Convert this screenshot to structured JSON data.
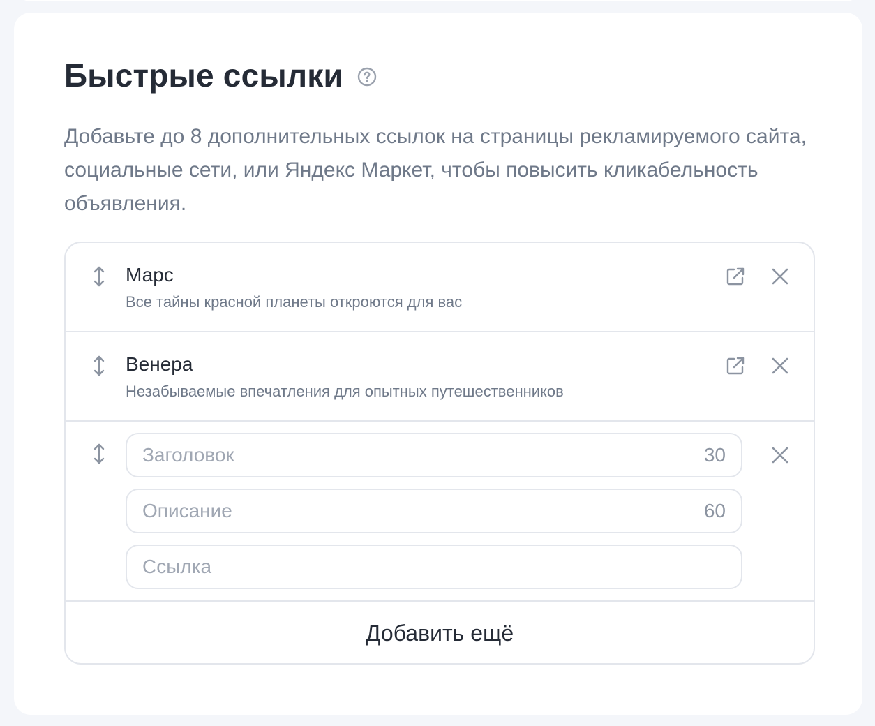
{
  "section": {
    "title": "Быстрые ссылки",
    "description": "Добавьте до 8 дополнительных ссылок на страницы рекламируемого сайта, социальные сети, или Яндекс Маркет, чтобы повысить кликабельность объявления."
  },
  "links": [
    {
      "title": "Марс",
      "description": "Все тайны красной планеты откроются для вас"
    },
    {
      "title": "Венера",
      "description": "Незабываемые впечатления для опытных путешественников"
    }
  ],
  "new_link": {
    "title_placeholder": "Заголовок",
    "title_counter": "30",
    "description_placeholder": "Описание",
    "description_counter": "60",
    "url_placeholder": "Ссылка"
  },
  "add_more_label": "Добавить ещё",
  "icons": {
    "help": "question-circle-icon",
    "drag": "drag-handle-icon",
    "open": "external-link-icon",
    "remove": "close-icon"
  },
  "colors": {
    "title": "#252b36",
    "muted": "#6f7989",
    "border": "#e3e6ec",
    "icon": "#8c94a1"
  }
}
